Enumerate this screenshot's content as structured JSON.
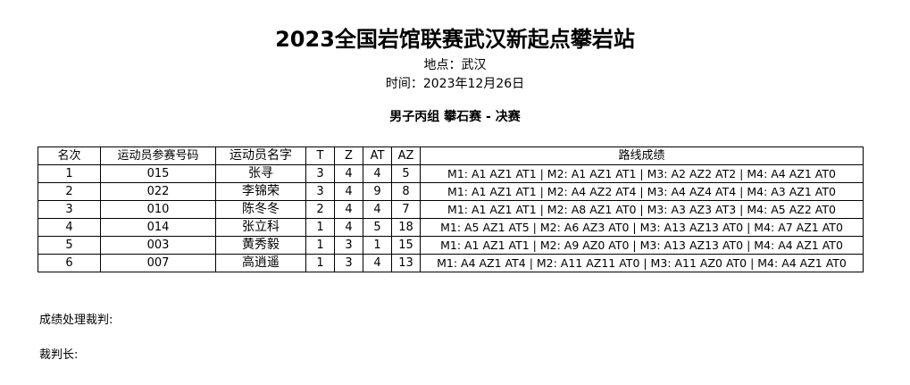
{
  "header": {
    "title": "2023全国岩馆联赛武汉新起点攀岩站",
    "location": "地点：武汉",
    "time": "时间：2023年12月26日",
    "event": "男子丙组 攀石赛 - 决赛"
  },
  "table": {
    "columns": [
      "名次",
      "运动员参赛号码",
      "运动员名字",
      "T",
      "Z",
      "AT",
      "AZ",
      "路线成绩"
    ],
    "rows": [
      [
        "1",
        "015",
        "张寻",
        "3",
        "4",
        "4",
        "5",
        "M1: A1 AZ1 AT1 | M2: A1 AZ1 AT1 | M3: A2 AZ2 AT2 | M4: A4 AZ1 AT0"
      ],
      [
        "2",
        "022",
        "李锦荣",
        "3",
        "4",
        "9",
        "8",
        "M1: A1 AZ1 AT1 | M2: A4 AZ2 AT4 | M3: A4 AZ4 AT4 | M4: A3 AZ1 AT0"
      ],
      [
        "3",
        "010",
        "陈冬冬",
        "2",
        "4",
        "4",
        "7",
        "M1: A1 AZ1 AT1 | M2: A8 AZ1 AT0 | M3: A3 AZ3 AT3 | M4: A5 AZ2 AT0"
      ],
      [
        "4",
        "014",
        "张立科",
        "1",
        "4",
        "5",
        "18",
        "M1: A5 AZ1 AT5 | M2: A6 AZ3 AT0 | M3: A13 AZ13 AT0 | M4: A7 AZ1 AT0"
      ],
      [
        "5",
        "003",
        "黄秀毅",
        "1",
        "3",
        "1",
        "15",
        "M1: A1 AZ1 AT1 | M2: A9 AZ0 AT0 | M3: A13 AZ13 AT0 | M4: A4 AZ1 AT0"
      ],
      [
        "6",
        "007",
        "高逍遥",
        "1",
        "3",
        "4",
        "13",
        "M1: A4 AZ1 AT4 | M2: A11 AZ11 AT0 | M3: A11 AZ0 AT0 | M4: A4 AZ1 AT0"
      ]
    ]
  },
  "footer": {
    "results_processing_judge": "成绩处理裁判:",
    "chief_judge": "裁判长:"
  }
}
